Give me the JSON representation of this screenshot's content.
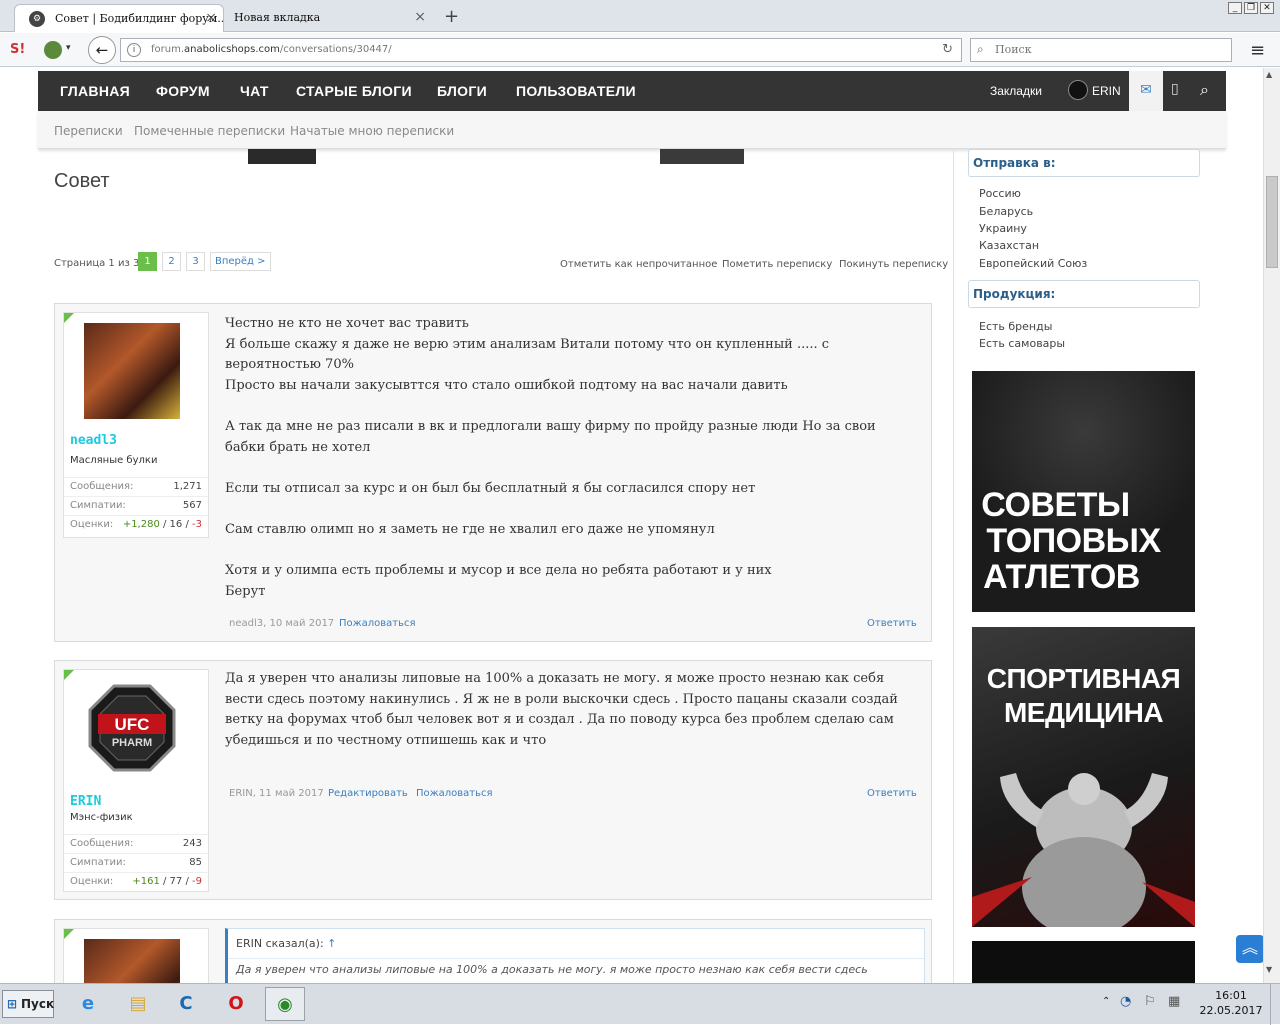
{
  "browser": {
    "tabs": [
      {
        "title": "Совет | Бодибилдинг форум...",
        "close": "×"
      },
      {
        "title": "Новая вкладка",
        "close": "×"
      }
    ],
    "new_tab": "+",
    "url_prefix": "forum.",
    "url_domain": "anabolicshops.com",
    "url_path": "/conversations/30447/",
    "search_placeholder": "Поиск",
    "window_buttons": [
      "_",
      "❐",
      "✕"
    ]
  },
  "site_nav": {
    "items": [
      "ГЛАВНАЯ",
      "ФОРУМ",
      "ЧАТ",
      "СТАРЫЕ БЛОГИ",
      "БЛОГИ",
      "ПОЛЬЗОВАТЕЛИ"
    ],
    "bookmarks": "Закладки",
    "user": "ERIN"
  },
  "sub_nav": [
    "Переписки",
    "Помеченные переписки",
    "Начатые мною переписки"
  ],
  "page": {
    "title": "Совет",
    "page_info": "Страница 1 из 3",
    "pages": [
      "1",
      "2",
      "3"
    ],
    "next": "Вперёд >",
    "actions": [
      "Отметить как непрочитанное",
      "Пометить переписку",
      "Покинуть переписку"
    ]
  },
  "posts": [
    {
      "username": "neadl3",
      "user_title": "Масляные булки",
      "stats": [
        {
          "label": "Сообщения:",
          "value": "1,271"
        },
        {
          "label": "Симпатии:",
          "value": "567"
        }
      ],
      "ratings_label": "Оценки:",
      "ratings_pos": "+1,280",
      "ratings_neu": " / 16 / ",
      "ratings_neg": "-3",
      "paragraphs": [
        "Честно не кто не хочет вас травить\nЯ больше скажу я даже не верю этим анализам Витали потому что он купленный ..... с вероятностью 70%\nПросто вы начали закусывттся что стало ошибкой подтому на вас начали давить",
        "А так да мне не раз писали в вк и предлогали вашу фирму по пройду разные люди Но за свои бабки брать не хотел",
        "Если ты отписал за курс и он был бы бесплатный я бы согласился спору нет",
        "Сам ставлю олимп но я заметь не где не хвалил его даже не упомянул",
        "Хотя и у олимпа есть проблемы и мусор и все дела но ребята работают и у них\nБерут"
      ],
      "meta": "neadl3, 10 май 2017",
      "links": [
        "Пожаловаться"
      ],
      "reply": "Ответить"
    },
    {
      "username": "ERIN",
      "user_title": "Мэнс-физик",
      "stats": [
        {
          "label": "Сообщения:",
          "value": "243"
        },
        {
          "label": "Симпатии:",
          "value": "85"
        }
      ],
      "ratings_label": "Оценки:",
      "ratings_pos": "+161",
      "ratings_neu": " / 77 / ",
      "ratings_neg": "-9",
      "paragraphs": [
        "Да я уверен что анализы липовые на 100% а доказать не могу. я може просто незнаю как себя вести сдесь поэтому накинулись . Я ж не в роли выскочки сдесь . Просто пацаны сказали создай ветку на форумах чтоб был человек вот я и создал . Да по поводу курса без проблем сделаю сам убедишься и по честному отпишешь как и что"
      ],
      "meta": "ERIN, 11 май 2017",
      "links": [
        "Редактировать",
        "Пожаловаться"
      ],
      "reply": "Ответить"
    }
  ],
  "quote": {
    "author": "ERIN сказал(а):",
    "arrow": "↑",
    "text": "Да я уверен что анализы липовые на 100% а доказать не могу. я може просто незнаю как себя вести сдесь"
  },
  "sidebar": {
    "shipping_title": "Отправка в:",
    "shipping": [
      "Россию",
      "Беларусь",
      "Украину",
      "Казахстан",
      "Европейский Союз"
    ],
    "products_title": "Продукция:",
    "products": [
      "Есть бренды",
      "Есть самовары"
    ],
    "banner1": [
      "СОВЕТЫ",
      "ТОПОВЫХ",
      "АТЛЕТОВ"
    ],
    "banner2": [
      "СПОРТИВНАЯ",
      "МЕДИЦИНА"
    ]
  },
  "taskbar": {
    "start": "Пуск",
    "time": "16:01",
    "date": "22.05.2017"
  },
  "colors": {
    "nav_bg": "#343434",
    "accent_green": "#6abf4b",
    "username": "#1cc9df",
    "link": "#3a7fc1"
  }
}
